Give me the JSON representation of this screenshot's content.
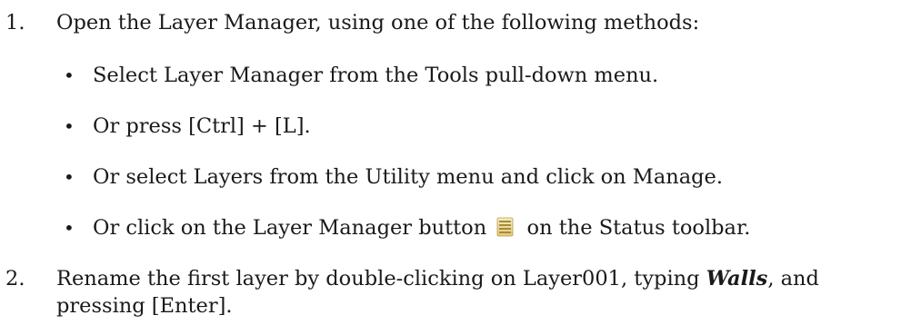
{
  "steps": [
    {
      "number": "1.",
      "text": "Open the Layer Manager, using one of the following methods:",
      "bullets": [
        {
          "text": "Select Layer Manager from the Tools pull-down menu."
        },
        {
          "text": "Or press [Ctrl] + [L]."
        },
        {
          "text": "Or select Layers from the Utility menu and click on Manage."
        },
        {
          "before": "Or click on the Layer Manager button",
          "icon": "layer-manager-icon",
          "after": "on the Status toolbar."
        }
      ]
    },
    {
      "number": "2.",
      "before": "Rename the first layer by double-clicking on Layer001, typing",
      "emphasis": "Walls",
      "after": ", and pressing [Enter]."
    }
  ],
  "bullet_glyph": "•"
}
